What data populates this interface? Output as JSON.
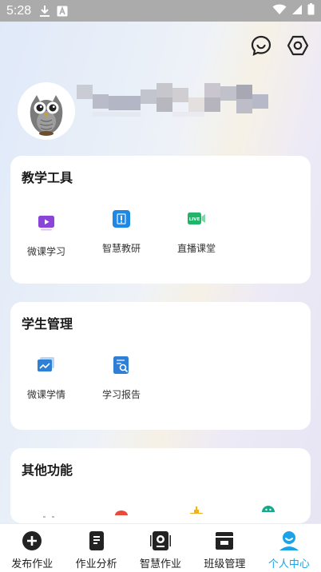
{
  "status_bar": {
    "time": "5:28"
  },
  "sections": [
    {
      "title": "教学工具",
      "tools": [
        {
          "label": "微课学习",
          "icon": "video-play-icon"
        },
        {
          "label": "智慧教研",
          "icon": "research-icon"
        },
        {
          "label": "直播课堂",
          "icon": "live-icon"
        }
      ]
    },
    {
      "title": "学生管理",
      "tools": [
        {
          "label": "微课学情",
          "icon": "chart-icon"
        },
        {
          "label": "学习报告",
          "icon": "report-icon"
        }
      ]
    },
    {
      "title": "其他功能",
      "tools": []
    }
  ],
  "bottom_nav": [
    {
      "label": "发布作业",
      "icon": "add-circle-icon",
      "active": false
    },
    {
      "label": "作业分析",
      "icon": "document-icon",
      "active": false
    },
    {
      "label": "智慧作业",
      "icon": "smart-homework-icon",
      "active": false
    },
    {
      "label": "班级管理",
      "icon": "class-icon",
      "active": false
    },
    {
      "label": "个人中心",
      "icon": "person-icon",
      "active": true
    }
  ],
  "colors": {
    "accent": "#1aa3e8",
    "video_icon": "#8a44d8",
    "research_icon": "#1e88e5",
    "live_icon": "#22b36a"
  }
}
